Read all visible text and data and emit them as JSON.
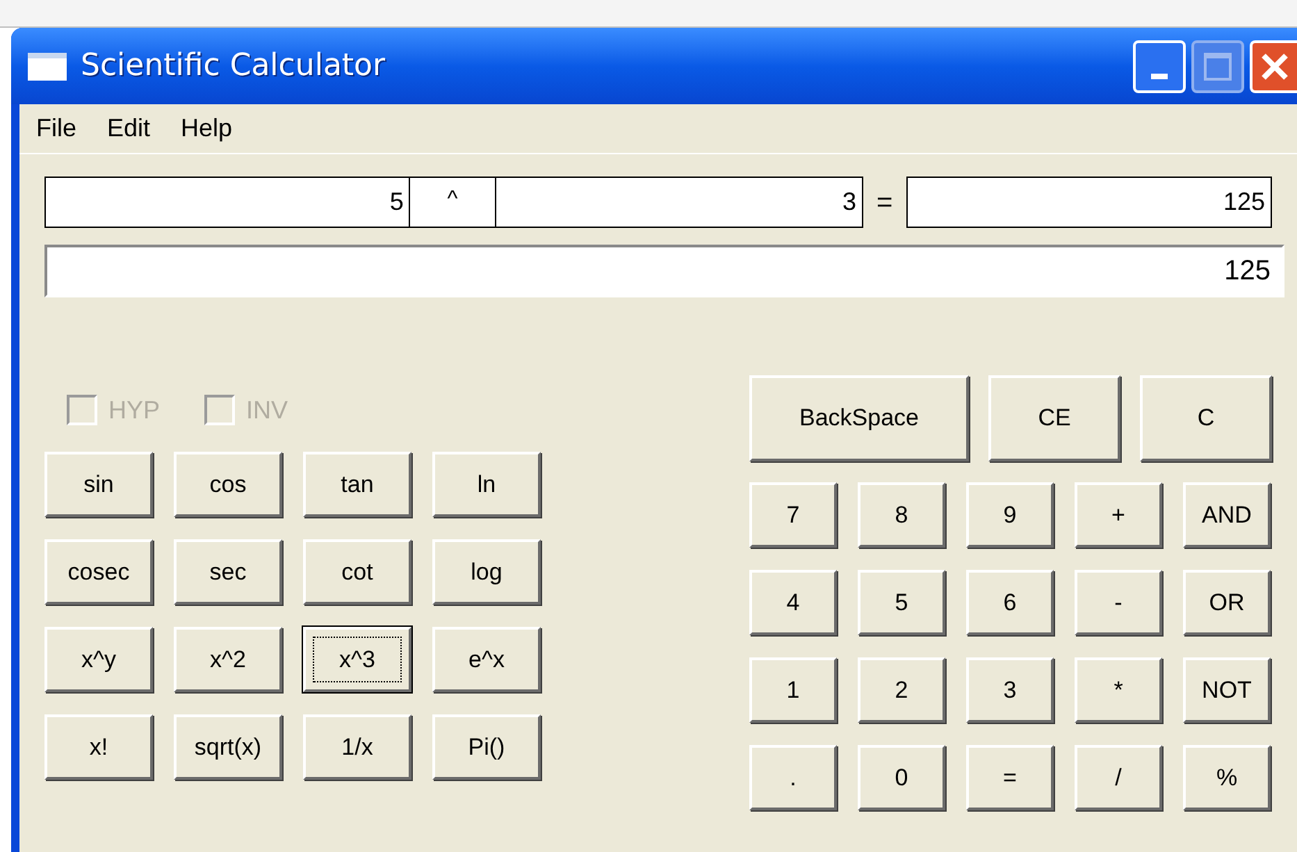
{
  "window": {
    "title": "Scientific Calculator"
  },
  "menu": [
    {
      "label": "File"
    },
    {
      "label": "Edit"
    },
    {
      "label": "Help"
    }
  ],
  "expression": {
    "operand_1": "5",
    "operator": "^",
    "operand_2": "3",
    "equals": "=",
    "result": "125"
  },
  "display": {
    "value": "125"
  },
  "options": [
    {
      "label": "HYP",
      "checked": false,
      "disabled": true
    },
    {
      "label": "INV",
      "checked": false,
      "disabled": true
    }
  ],
  "function_keys": [
    [
      {
        "label": "sin",
        "focused": false
      },
      {
        "label": "cos",
        "focused": false
      },
      {
        "label": "tan",
        "focused": false
      },
      {
        "label": "ln",
        "focused": false
      }
    ],
    [
      {
        "label": "cosec",
        "focused": false
      },
      {
        "label": "sec",
        "focused": false
      },
      {
        "label": "cot",
        "focused": false
      },
      {
        "label": "log",
        "focused": false
      }
    ],
    [
      {
        "label": "x^y",
        "focused": false
      },
      {
        "label": "x^2",
        "focused": false
      },
      {
        "label": "x^3",
        "focused": true
      },
      {
        "label": "e^x",
        "focused": false
      }
    ],
    [
      {
        "label": "x!",
        "focused": false
      },
      {
        "label": "sqrt(x)",
        "focused": false
      },
      {
        "label": "1/x",
        "focused": false
      },
      {
        "label": "Pi()",
        "focused": false
      }
    ]
  ],
  "control_keys": [
    {
      "label": "BackSpace",
      "focused": false
    },
    {
      "label": "CE",
      "focused": false
    },
    {
      "label": "C",
      "focused": false
    }
  ],
  "number_keys": [
    [
      {
        "label": "7",
        "focused": false
      },
      {
        "label": "8",
        "focused": false
      },
      {
        "label": "9",
        "focused": false
      },
      {
        "label": "+",
        "focused": false
      },
      {
        "label": "AND",
        "focused": false
      }
    ],
    [
      {
        "label": "4",
        "focused": false
      },
      {
        "label": "5",
        "focused": false
      },
      {
        "label": "6",
        "focused": false
      },
      {
        "label": "-",
        "focused": false
      },
      {
        "label": "OR",
        "focused": false
      }
    ],
    [
      {
        "label": "1",
        "focused": false
      },
      {
        "label": "2",
        "focused": false
      },
      {
        "label": "3",
        "focused": false
      },
      {
        "label": "*",
        "focused": false
      },
      {
        "label": "NOT",
        "focused": false
      }
    ],
    [
      {
        "label": ".",
        "focused": false
      },
      {
        "label": "0",
        "focused": false
      },
      {
        "label": "=",
        "focused": false
      },
      {
        "label": "/",
        "focused": false
      },
      {
        "label": "%",
        "focused": false
      }
    ]
  ]
}
